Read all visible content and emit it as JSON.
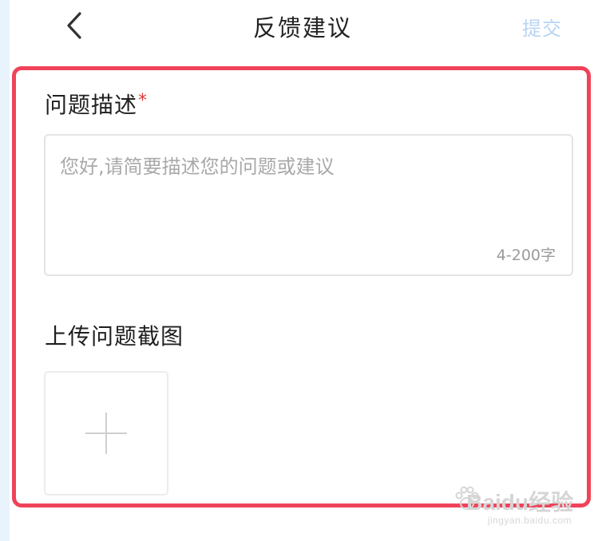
{
  "header": {
    "back_icon": "chevron-left-icon",
    "title": "反馈建议",
    "submit_label": "提交"
  },
  "form": {
    "problem_description": {
      "label": "问题描述",
      "required_mark": "*",
      "placeholder": "您好,请简要描述您的问题或建议",
      "char_limit": "4-200字"
    },
    "screenshot_upload": {
      "label": "上传问题截图",
      "add_icon": "plus-icon"
    }
  },
  "watermark": {
    "logo_text": "Baidu经验",
    "site": "jingyan.baidu.com"
  },
  "colors": {
    "highlight": "#f0435a",
    "submit_disabled": "#b8d4f3",
    "required": "#e23a3a"
  }
}
